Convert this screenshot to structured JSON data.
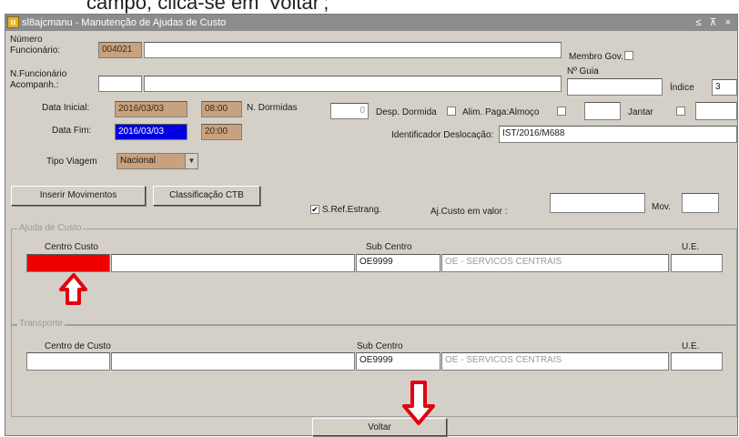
{
  "doc_fragment": "campo, clica-se em 'Voltar';",
  "window": {
    "title": "sl8ajcmanu - Manutenção de Ajudas de Custo",
    "controls": "≤ ⊼ ×"
  },
  "form": {
    "numero_label": "Número Funcionário:",
    "numero_value": "004021",
    "membro_gov_label": "Membro Gov.",
    "nfunc_acomp_label": "N.Funcionário Acompanh.:",
    "nguia_label": "Nº Guia",
    "indice_label": "Índice",
    "indice_value": "3",
    "data_inicial_label": "Data Inicial:",
    "data_inicial_value": "2016/03/03",
    "hora_inicial_value": "08:00",
    "n_dormidas_label": "N. Dormidas",
    "n_dormidas_value": "0",
    "desp_dormida_label": "Desp. Dormida",
    "alim_paga_almoco_label": "Alim. Paga:Almoço",
    "jantar_label": "Jantar",
    "data_fim_label": "Data Fim:",
    "data_fim_value": "2016/03/03",
    "hora_fim_value": "20:00",
    "ident_desloc_label": "Identificador Deslocação:",
    "ident_desloc_value": "IST/2016/M688",
    "tipo_viagem_label": "Tipo Viagem",
    "tipo_viagem_value": "Nacional",
    "btn_inserir": "Inserir Movimentos",
    "btn_classificacao": "Classificação CTB",
    "sref_estrang_label": "S.Ref.Estrang.",
    "aj_custo_valor_label": "Aj.Custo em valor :",
    "mov_label": "Mov."
  },
  "ajuda_custo": {
    "group_title": "Ajuda de Custo",
    "centro_custo_label": "Centro Custo",
    "sub_centro_label": "Sub Centro",
    "ue_label": "U.E.",
    "sub_centro_code": "OE9999",
    "sub_centro_desc": "OE - SERVICOS CENTRAIS"
  },
  "transporte": {
    "group_title": "Transporte",
    "centro_custo_label": "Centro de Custo",
    "sub_centro_label": "Sub Centro",
    "ue_label": "U.E.",
    "sub_centro_code": "OE9999",
    "sub_centro_desc": "OE - SERVICOS CENTRAIS"
  },
  "btn_voltar": "Voltar",
  "colors": {
    "highlight_red": "#ef0000",
    "annotation_arrow": "#e3000f",
    "field_tan": "#c8a27e",
    "field_blue": "#0000e0",
    "window_bg": "#d4d0c8"
  }
}
